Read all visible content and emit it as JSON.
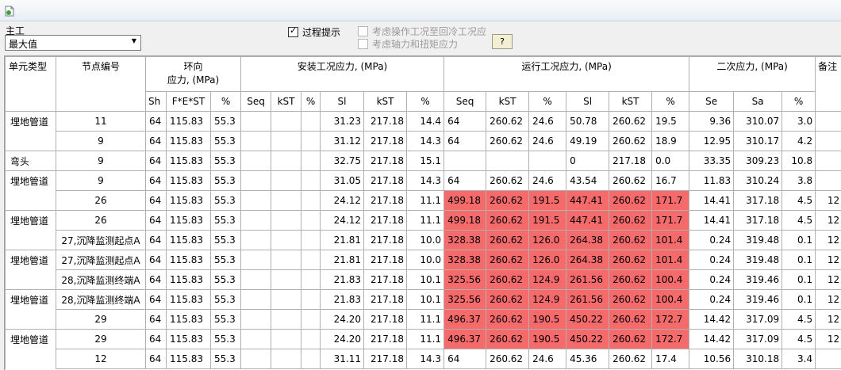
{
  "window": {
    "icon": "document-refresh-icon"
  },
  "controls": {
    "case_label": "主工",
    "case_value": "最大值",
    "show_process_label": "过程提示",
    "show_process_checked": true,
    "consider_cold_label": "考虑操作工况至回冷工况应",
    "consider_axial_label": "考虑轴力和扭矩应力",
    "help_label": "?"
  },
  "table": {
    "group_headers": {
      "element_type": "单元类型",
      "node_no": "节点编号",
      "hoop_line1": "环向",
      "hoop_line2": "应力, (MPa)",
      "install": "安装工况应力, (MPa)",
      "operating": "运行工况应力, (MPa)",
      "secondary": "二次应力, (MPa)",
      "remark": "备注"
    },
    "sub_headers": [
      "Sh",
      "F*E*ST",
      "%",
      "Seq",
      "kST",
      "%",
      "Sl",
      "kST",
      "%",
      "Seq",
      "kST",
      "%",
      "Sl",
      "kST",
      "%",
      "Se",
      "Sa",
      "%"
    ],
    "highlight_color": "#f56a6a",
    "rows": [
      {
        "etype": "埋地管道",
        "node": "11",
        "c": [
          "64",
          "115.83",
          "55.3",
          "",
          "",
          "",
          "31.23",
          "217.18",
          "14.4",
          "64",
          "260.62",
          "24.6",
          "50.78",
          "260.62",
          "19.5",
          "9.36",
          "310.07",
          "3.0"
        ],
        "remark": "",
        "hl": false,
        "first": true,
        "band": false
      },
      {
        "etype": "",
        "node": "9",
        "c": [
          "64",
          "115.83",
          "55.3",
          "",
          "",
          "",
          "31.12",
          "217.18",
          "14.3",
          "64",
          "260.62",
          "24.6",
          "49.19",
          "260.62",
          "18.9",
          "12.95",
          "310.17",
          "4.2"
        ],
        "remark": "",
        "hl": false,
        "first": false,
        "band": true
      },
      {
        "etype": "弯头",
        "node": "9",
        "c": [
          "64",
          "115.83",
          "55.3",
          "",
          "",
          "",
          "32.75",
          "217.18",
          "15.1",
          "",
          "",
          "",
          "0",
          "217.18",
          "0.0",
          "33.35",
          "309.23",
          "10.8"
        ],
        "remark": "",
        "hl": false,
        "first": true,
        "band": true
      },
      {
        "etype": "埋地管道",
        "node": "9",
        "c": [
          "64",
          "115.83",
          "55.3",
          "",
          "",
          "",
          "31.05",
          "217.18",
          "14.3",
          "64",
          "260.62",
          "24.6",
          "43.54",
          "260.62",
          "16.7",
          "11.83",
          "310.24",
          "3.8"
        ],
        "remark": "",
        "hl": false,
        "first": true,
        "band": false
      },
      {
        "etype": "",
        "node": "26",
        "c": [
          "64",
          "115.83",
          "55.3",
          "",
          "",
          "",
          "24.12",
          "217.18",
          "11.1",
          "499.18",
          "260.62",
          "191.5",
          "447.41",
          "260.62",
          "171.7",
          "14.41",
          "317.18",
          "4.5"
        ],
        "remark": "12",
        "hl": true,
        "first": false,
        "band": true
      },
      {
        "etype": "埋地管道",
        "node": "26",
        "c": [
          "64",
          "115.83",
          "55.3",
          "",
          "",
          "",
          "24.12",
          "217.18",
          "11.1",
          "499.18",
          "260.62",
          "191.5",
          "447.41",
          "260.62",
          "171.7",
          "14.41",
          "317.18",
          "4.5"
        ],
        "remark": "12",
        "hl": true,
        "first": true,
        "band": false
      },
      {
        "etype": "",
        "node": "27,沉降监测起点A",
        "c": [
          "64",
          "115.83",
          "55.3",
          "",
          "",
          "",
          "21.81",
          "217.18",
          "10.0",
          "328.38",
          "260.62",
          "126.0",
          "264.38",
          "260.62",
          "101.4",
          "0.24",
          "319.48",
          "0.1"
        ],
        "remark": "12",
        "hl": true,
        "first": false,
        "band": true
      },
      {
        "etype": "埋地管道",
        "node": "27,沉降监测起点A",
        "c": [
          "64",
          "115.83",
          "55.3",
          "",
          "",
          "",
          "21.81",
          "217.18",
          "10.0",
          "328.38",
          "260.62",
          "126.0",
          "264.38",
          "260.62",
          "101.4",
          "0.24",
          "319.48",
          "0.1"
        ],
        "remark": "12",
        "hl": true,
        "first": true,
        "band": false
      },
      {
        "etype": "",
        "node": "28,沉降监测终端A",
        "c": [
          "64",
          "115.83",
          "55.3",
          "",
          "",
          "",
          "21.83",
          "217.18",
          "10.1",
          "325.56",
          "260.62",
          "124.9",
          "261.56",
          "260.62",
          "100.4",
          "0.24",
          "319.46",
          "0.1"
        ],
        "remark": "12",
        "hl": true,
        "first": false,
        "band": true
      },
      {
        "etype": "埋地管道",
        "node": "28,沉降监测终端A",
        "c": [
          "64",
          "115.83",
          "55.3",
          "",
          "",
          "",
          "21.83",
          "217.18",
          "10.1",
          "325.56",
          "260.62",
          "124.9",
          "261.56",
          "260.62",
          "100.4",
          "0.24",
          "319.46",
          "0.1"
        ],
        "remark": "12",
        "hl": true,
        "first": true,
        "band": false
      },
      {
        "etype": "",
        "node": "29",
        "c": [
          "64",
          "115.83",
          "55.3",
          "",
          "",
          "",
          "24.20",
          "217.18",
          "11.1",
          "496.37",
          "260.62",
          "190.5",
          "450.22",
          "260.62",
          "172.7",
          "14.42",
          "317.09",
          "4.5"
        ],
        "remark": "12",
        "hl": true,
        "first": false,
        "band": true
      },
      {
        "etype": "埋地管道",
        "node": "29",
        "c": [
          "64",
          "115.83",
          "55.3",
          "",
          "",
          "",
          "24.20",
          "217.18",
          "11.1",
          "496.37",
          "260.62",
          "190.5",
          "450.22",
          "260.62",
          "172.7",
          "14.42",
          "317.09",
          "4.5"
        ],
        "remark": "12",
        "hl": true,
        "first": true,
        "band": false
      },
      {
        "etype": "",
        "node": "12",
        "c": [
          "64",
          "115.83",
          "55.3",
          "",
          "",
          "",
          "31.11",
          "217.18",
          "14.3",
          "64",
          "260.62",
          "24.6",
          "45.36",
          "260.62",
          "17.4",
          "10.56",
          "310.18",
          "3.4"
        ],
        "remark": "",
        "hl": false,
        "first": false,
        "band": false
      }
    ]
  }
}
